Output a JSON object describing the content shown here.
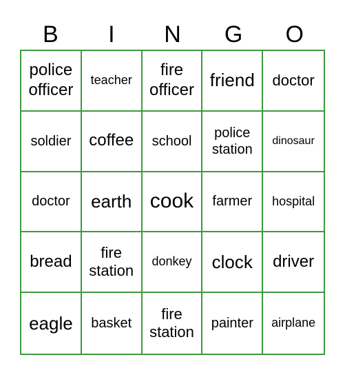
{
  "header": {
    "letters": [
      "B",
      "I",
      "N",
      "G",
      "O"
    ]
  },
  "board": {
    "rows": [
      [
        "police officer",
        "teacher",
        "fire officer",
        "friend",
        "doctor"
      ],
      [
        "soldier",
        "coffee",
        "school",
        "police station",
        "dinosaur"
      ],
      [
        "doctor",
        "earth",
        "cook",
        "farmer",
        "hospital"
      ],
      [
        "bread",
        "fire station",
        "donkey",
        "clock",
        "driver"
      ],
      [
        "eagle",
        "basket",
        "fire station",
        "painter",
        "airplane"
      ]
    ]
  },
  "colors": {
    "grid_line": "#3d9a3d",
    "text": "#000000",
    "background": "#ffffff"
  }
}
